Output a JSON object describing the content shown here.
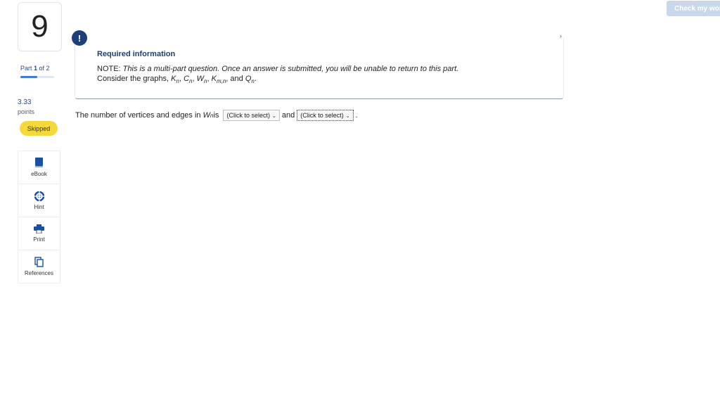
{
  "header": {
    "check_button_label": "Check my work"
  },
  "question": {
    "number": "9",
    "part_label_prefix": "Part ",
    "part_current": "1",
    "part_of": " of 2",
    "part_progress": 0.5,
    "points_value": "3.33",
    "points_label": "points",
    "status_badge": "Skipped"
  },
  "tools": [
    {
      "label": "eBook",
      "icon": "book-icon"
    },
    {
      "label": "Hint",
      "icon": "lifebuoy-icon"
    },
    {
      "label": "Print",
      "icon": "printer-icon"
    },
    {
      "label": "References",
      "icon": "copy-icon"
    }
  ],
  "info": {
    "alert_glyph": "!",
    "title": "Required information",
    "note_prefix": "NOTE: ",
    "note_text": "This is a multi-part question. Once an answer is submitted, you will be unable to return to this part.",
    "consider_prefix": "Consider the graphs, ",
    "graphs": [
      "K",
      "C",
      "W",
      "K"
    ],
    "graph_subs": [
      "n",
      "n",
      "n",
      "m,n"
    ],
    "consider_and": ", and ",
    "last_graph": "Q",
    "last_sub": "n",
    "consider_end": "."
  },
  "prompt": {
    "text_before": "The number of vertices and edges in ",
    "graph": "W",
    "graph_sub": "n",
    "text_is": " is ",
    "select1_value": "(Click to select)",
    "text_and": " and ",
    "select2_value": "(Click to select)",
    "text_end": "."
  }
}
